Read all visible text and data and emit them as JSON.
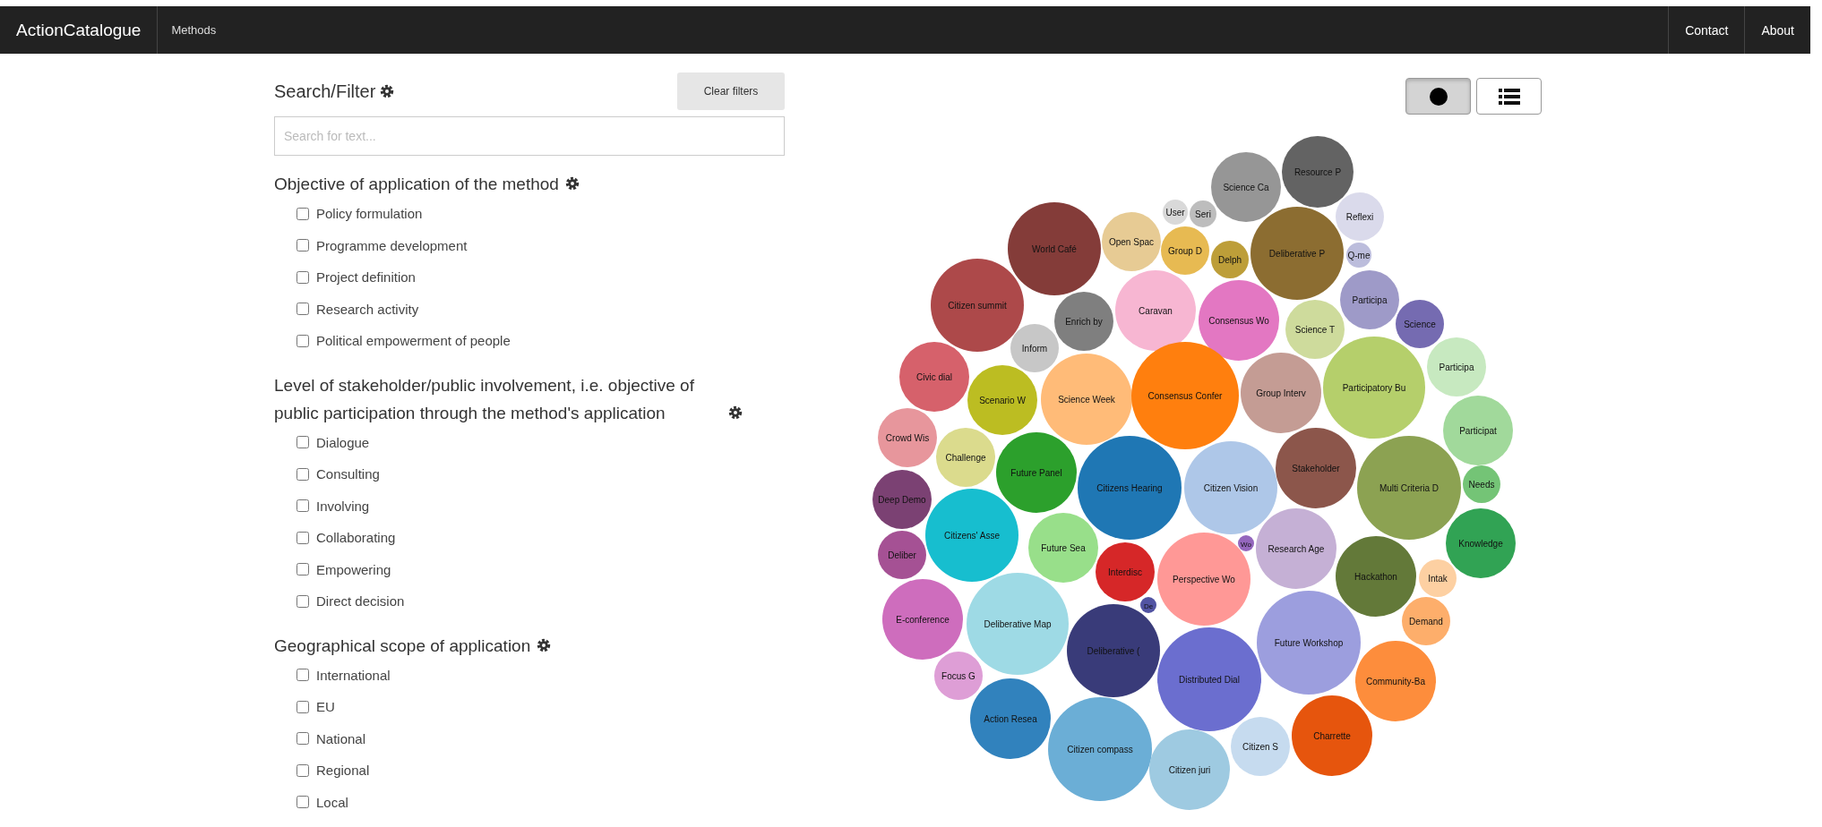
{
  "navbar": {
    "brand": "ActionCatalogue",
    "links": [
      "Methods"
    ],
    "right_links": [
      "Contact",
      "About"
    ]
  },
  "filter_panel": {
    "title": "Search/Filter",
    "clear_button": "Clear filters",
    "search": {
      "placeholder": "Search for text..."
    },
    "groups": [
      {
        "title": "Objective of application of the method",
        "options": [
          {
            "label": "Policy formulation",
            "checked": false
          },
          {
            "label": "Programme development",
            "checked": false
          },
          {
            "label": "Project definition",
            "checked": false
          },
          {
            "label": "Research activity",
            "checked": false
          },
          {
            "label": "Political empowerment of people",
            "checked": false
          }
        ]
      },
      {
        "title": "Level of stakeholder/public involvement, i.e. objective of public participation through the method's application",
        "options": [
          {
            "label": "Dialogue",
            "checked": false
          },
          {
            "label": "Consulting",
            "checked": false
          },
          {
            "label": "Involving",
            "checked": false
          },
          {
            "label": "Collaborating",
            "checked": false
          },
          {
            "label": "Empowering",
            "checked": false
          },
          {
            "label": "Direct decision",
            "checked": false
          }
        ]
      },
      {
        "title": "Geographical scope of application",
        "options": [
          {
            "label": "International",
            "checked": false
          },
          {
            "label": "EU",
            "checked": false
          },
          {
            "label": "National",
            "checked": false
          },
          {
            "label": "Regional",
            "checked": false
          },
          {
            "label": "Local",
            "checked": false
          }
        ]
      }
    ]
  },
  "view_toggle": [
    {
      "kind": "bubbles",
      "selected": true
    },
    {
      "kind": "list",
      "selected": false
    }
  ],
  "bubbles": [
    {
      "label": "Resource P",
      "color": "#636363"
    },
    {
      "label": "Science Ca",
      "color": "#969696"
    },
    {
      "label": "User",
      "color": "#d9d9d9"
    },
    {
      "label": "Seri",
      "color": "#bdbdbd"
    },
    {
      "label": "Reflexi",
      "color": "#dadaeb"
    },
    {
      "label": "World Café",
      "color": "#843c39"
    },
    {
      "label": "Open Spac",
      "color": "#e7cb94"
    },
    {
      "label": "Group D",
      "color": "#e7ba52"
    },
    {
      "label": "Delph",
      "color": "#bd9e39"
    },
    {
      "label": "Deliberative P",
      "color": "#8c6d31"
    },
    {
      "label": "Q-me",
      "color": "#bcbddc"
    },
    {
      "label": "Citizen summit",
      "color": "#ad494a"
    },
    {
      "label": "Caravan",
      "color": "#f7b6d2"
    },
    {
      "label": "Participa",
      "color": "#9e9ac8"
    },
    {
      "label": "Enrich by",
      "color": "#7f7f7f"
    },
    {
      "label": "Consensus Wo",
      "color": "#e377c2"
    },
    {
      "label": "Science T",
      "color": "#cedb9c"
    },
    {
      "label": "Science",
      "color": "#756bb1"
    },
    {
      "label": "Inform",
      "color": "#c7c7c7"
    },
    {
      "label": "Participa",
      "color": "#c7e9c0"
    },
    {
      "label": "Civic dial",
      "color": "#d6616b"
    },
    {
      "label": "Scenario W",
      "color": "#bcbd22"
    },
    {
      "label": "Science Week",
      "color": "#ffbb78"
    },
    {
      "label": "Consensus Confer",
      "color": "#ff7f0e"
    },
    {
      "label": "Group Interv",
      "color": "#c49c94"
    },
    {
      "label": "Participatory Bu",
      "color": "#b5cf6b"
    },
    {
      "label": "Crowd Wis",
      "color": "#e7969c"
    },
    {
      "label": "Participat",
      "color": "#a1d99b"
    },
    {
      "label": "Challenge",
      "color": "#dbdb8d"
    },
    {
      "label": "Future Panel",
      "color": "#2ca02c"
    },
    {
      "label": "Stakeholder",
      "color": "#8c564b"
    },
    {
      "label": "Citizens Hearing",
      "color": "#1f77b4"
    },
    {
      "label": "Citizen Vision",
      "color": "#aec7e8"
    },
    {
      "label": "Multi Criteria D",
      "color": "#8ca252"
    },
    {
      "label": "Needs",
      "color": "#74c476"
    },
    {
      "label": "Deep Demo",
      "color": "#7b4173"
    },
    {
      "label": "Deliber",
      "color": "#a55194"
    },
    {
      "label": "Citizens' Asse",
      "color": "#17becf"
    },
    {
      "label": "Future Sea",
      "color": "#98df8a"
    },
    {
      "label": "Wo",
      "color": "#9467bd"
    },
    {
      "label": "Research Age",
      "color": "#c5b0d5"
    },
    {
      "label": "Knowledge",
      "color": "#31a354"
    },
    {
      "label": "Interdisc",
      "color": "#d62728"
    },
    {
      "label": "Perspective Wo",
      "color": "#ff9896"
    },
    {
      "label": "Hackathon",
      "color": "#637939"
    },
    {
      "label": "Intak",
      "color": "#fdd0a2"
    },
    {
      "label": "De",
      "color": "#5254a3"
    },
    {
      "label": "E-conference",
      "color": "#ce6dbd"
    },
    {
      "label": "Deliberative Map",
      "color": "#9edae5"
    },
    {
      "label": "Demand",
      "color": "#fdae6b"
    },
    {
      "label": "Deliberative (",
      "color": "#393b79"
    },
    {
      "label": "Future Workshop",
      "color": "#9c9ede"
    },
    {
      "label": "Focus G",
      "color": "#de9ed6"
    },
    {
      "label": "Distributed Dial",
      "color": "#6b6ecf"
    },
    {
      "label": "Community-Ba",
      "color": "#fd8d3c"
    },
    {
      "label": "Action Resea",
      "color": "#3182bd"
    },
    {
      "label": "Charrette",
      "color": "#e6550d"
    },
    {
      "label": "Citizen compass",
      "color": "#6baed6"
    },
    {
      "label": "Citizen S",
      "color": "#c6dbef"
    },
    {
      "label": "Citizen juri",
      "color": "#9ecae1"
    }
  ]
}
